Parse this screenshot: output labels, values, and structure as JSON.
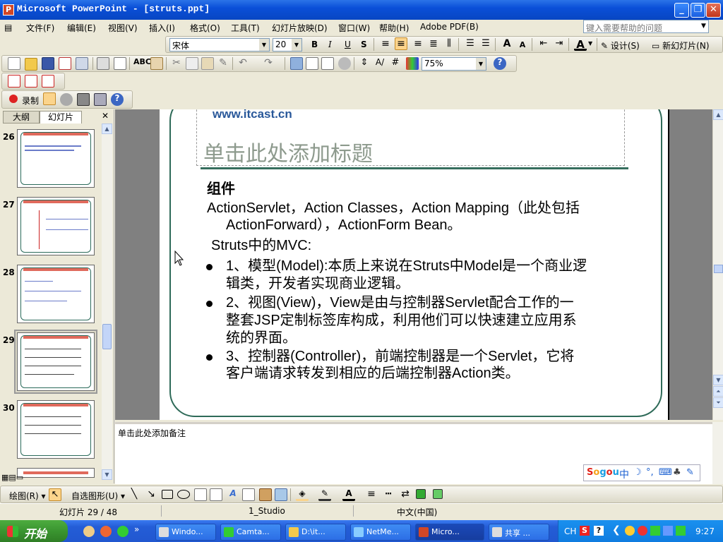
{
  "window": {
    "title": "Microsoft PowerPoint - [struts.ppt]",
    "minimize": "_",
    "restore": "❐",
    "close": "✕"
  },
  "menu": {
    "items": [
      "文件(F)",
      "编辑(E)",
      "视图(V)",
      "插入(I)",
      "格式(O)",
      "工具(T)",
      "幻灯片放映(D)",
      "窗口(W)",
      "帮助(H)",
      "Adobe PDF(B)"
    ],
    "help_placeholder": "键入需要帮助的问题"
  },
  "format_toolbar": {
    "font": "宋体",
    "size": "20",
    "bold": "B",
    "italic": "I",
    "underline": "U",
    "shadow": "S",
    "design": "设计(S)",
    "new_slide": "新幻灯片(N)"
  },
  "standard_toolbar": {
    "zoom": "75%"
  },
  "record_toolbar": {
    "record": "录制"
  },
  "panel": {
    "tab_outline": "大纲",
    "tab_slides": "幻灯片",
    "close": "✕",
    "slides": [
      {
        "num": "26"
      },
      {
        "num": "27"
      },
      {
        "num": "28"
      },
      {
        "num": "29",
        "selected": true
      },
      {
        "num": "30"
      }
    ]
  },
  "slide": {
    "logo": "www.itcast.cn",
    "title": "单击此处添加标题",
    "heading": "组件",
    "line1": "ActionServlet，Action Classes，Action Mapping（此处包括",
    "line2": "ActionForward），ActionForm Bean。",
    "line3": "Struts中的MVC:",
    "b1_l1": "1、模型(Model):本质上来说在Struts中Model是一个商业逻",
    "b1_l2": "辑类，开发者实现商业逻辑。",
    "b2_l1": "  2、视图(View)，View是由与控制器Servlet配合工作的一",
    "b2_l2": "整套JSP定制标签库构成，利用他们可以快速建立应用系",
    "b2_l3": "统的界面。",
    "b3_l1": "  3、控制器(Controller)，前端控制器是一个Servlet，它将",
    "b3_l2": "客户端请求转发到相应的后端控制器Action类。"
  },
  "notes": {
    "placeholder": "单击此处添加备注"
  },
  "draw_toolbar": {
    "draw": "绘图(R)",
    "autoshapes": "自选图形(U)"
  },
  "status": {
    "slide": "幻灯片 29 / 48",
    "design": "1_Studio",
    "lang": "中文(中国)"
  },
  "taskbar": {
    "start": "开始",
    "tasks": [
      "Windo...",
      "Camta...",
      "D:\\it...",
      "NetMe...",
      "Micro...",
      "共享 ..."
    ],
    "clock": "9:27",
    "ime": "CH"
  },
  "colors": {
    "title_bar": "#0a4fd8",
    "slide_frame": "#2e6a58",
    "title_text": "#8d9a8d",
    "logo": "#29589a"
  }
}
